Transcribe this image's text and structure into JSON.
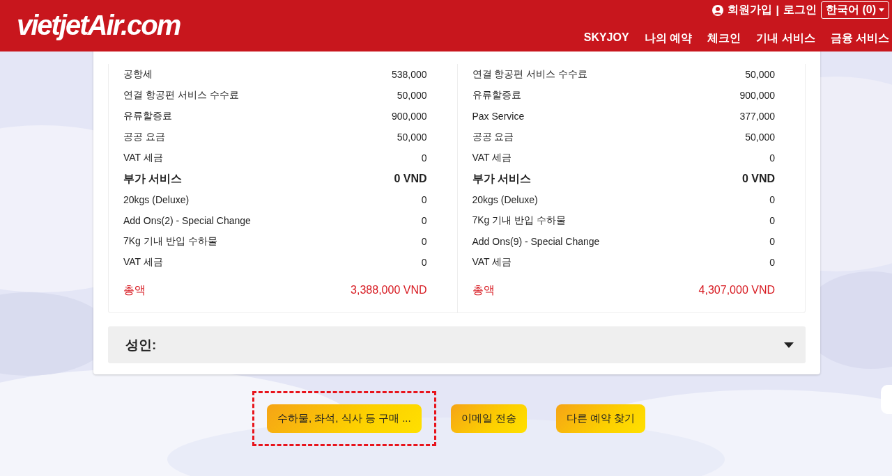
{
  "header": {
    "logo": "vietjetAir.com",
    "account_links": [
      {
        "label": "회원가입"
      },
      {
        "label": "로그인"
      }
    ],
    "separator": "|",
    "language": {
      "label": "한국어 (0)"
    },
    "nav": [
      {
        "label": "SKYJOY"
      },
      {
        "label": "나의 예약"
      },
      {
        "label": "체크인"
      },
      {
        "label": "기내 서비스"
      },
      {
        "label": "금융 서비스"
      }
    ]
  },
  "fare_columns": [
    {
      "rows": [
        {
          "kind": "item",
          "label": "공항세",
          "value": "538,000"
        },
        {
          "kind": "item",
          "label": "연결 항공편 서비스 수수료",
          "value": "50,000"
        },
        {
          "kind": "item",
          "label": "유류할증료",
          "value": "900,000"
        },
        {
          "kind": "item",
          "label": "공공 요금",
          "value": "50,000"
        },
        {
          "kind": "item",
          "label": "VAT 세금",
          "value": "0"
        },
        {
          "kind": "section",
          "label": "부가 서비스",
          "value": "0 VND"
        },
        {
          "kind": "item",
          "label": "20kgs (Deluxe)",
          "value": "0"
        },
        {
          "kind": "item",
          "label": "Add Ons(2) - Special Change",
          "value": "0"
        },
        {
          "kind": "item",
          "label": "7Kg 기내 반입 수하물",
          "value": "0"
        },
        {
          "kind": "item",
          "label": "VAT 세금",
          "value": "0"
        },
        {
          "kind": "total",
          "label": "총액",
          "value": "3,388,000 VND"
        }
      ]
    },
    {
      "rows": [
        {
          "kind": "item",
          "label": "연결 항공편 서비스 수수료",
          "value": "50,000"
        },
        {
          "kind": "item",
          "label": "유류할증료",
          "value": "900,000"
        },
        {
          "kind": "item",
          "label": "Pax Service",
          "value": "377,000"
        },
        {
          "kind": "item",
          "label": "공공 요금",
          "value": "50,000"
        },
        {
          "kind": "item",
          "label": "VAT 세금",
          "value": "0"
        },
        {
          "kind": "section",
          "label": "부가 서비스",
          "value": "0 VND"
        },
        {
          "kind": "item",
          "label": "20kgs (Deluxe)",
          "value": "0"
        },
        {
          "kind": "item",
          "label": "7Kg 기내 반입 수하물",
          "value": "0"
        },
        {
          "kind": "item",
          "label": "Add Ons(9) - Special Change",
          "value": "0"
        },
        {
          "kind": "item",
          "label": "VAT 세금",
          "value": "0"
        },
        {
          "kind": "total",
          "label": "총액",
          "value": "4,307,000 VND"
        }
      ]
    }
  ],
  "passenger_section": {
    "label": "성인:",
    "expanded": false
  },
  "buttons": [
    {
      "label": "수하물, 좌석, 식사 등 구매 ...",
      "highlighted": true
    },
    {
      "label": "이메일 전송",
      "highlighted": false
    },
    {
      "label": "다른 예약 찾기",
      "highlighted": false
    }
  ]
}
